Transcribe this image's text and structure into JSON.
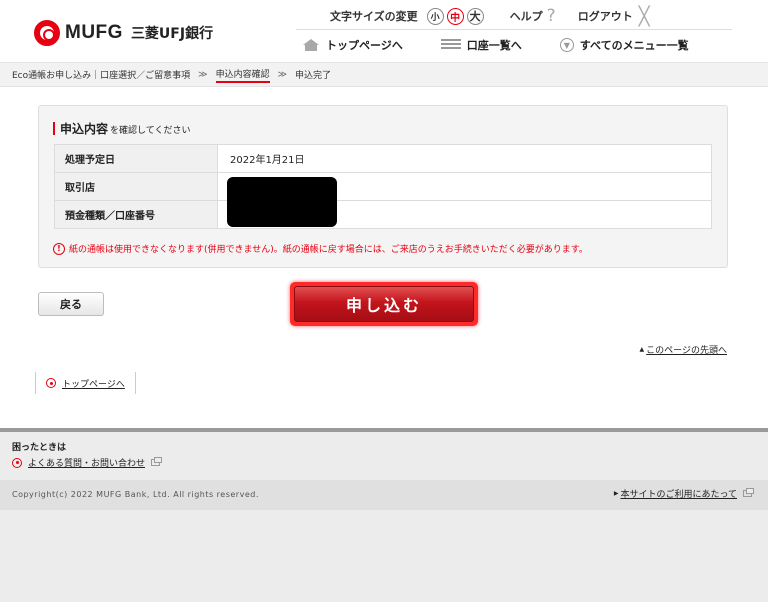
{
  "header": {
    "brand": "MUFG",
    "brand_sub": "三菱UFJ銀行",
    "font_size_label": "文字サイズの変更",
    "font_sizes": [
      "小",
      "中",
      "大"
    ],
    "help": "ヘルプ",
    "logout": "ログアウト"
  },
  "nav": {
    "top_page": "トップページへ",
    "accounts": "口座一覧へ",
    "all_menu": "すべてのメニュー一覧"
  },
  "breadcrumb": {
    "step1": "Eco通帳お申し込み｜口座選択／ご留意事項",
    "separator": "≫",
    "step2": "申込内容確認",
    "step3": "申込完了"
  },
  "confirm": {
    "title_main": "申込内容",
    "title_sub": "を確認してください",
    "rows": [
      {
        "label": "処理予定日",
        "value": "2022年1月21日"
      },
      {
        "label": "取引店",
        "value": ""
      },
      {
        "label": "預金種類／口座番号",
        "value": ""
      }
    ],
    "notice": "紙の通帳は使用できなくなります(併用できません)。紙の通帳に戻す場合には、ご来店のうえお手続きいただく必要があります。"
  },
  "actions": {
    "back": "戻る",
    "apply": "申し込む"
  },
  "page_top": "このページの先頭へ",
  "footer_nav": {
    "top_page": "トップページへ"
  },
  "help_section": {
    "title": "困ったときは",
    "faq": "よくある質問・お問い合わせ"
  },
  "footer": {
    "copyright": "Copyright(c) 2022 MUFG Bank, Ltd. All rights reserved.",
    "terms": "本サイトのご利用にあたって"
  },
  "colors": {
    "brand_red": "#e60012",
    "footer_gray": "#ececec"
  }
}
